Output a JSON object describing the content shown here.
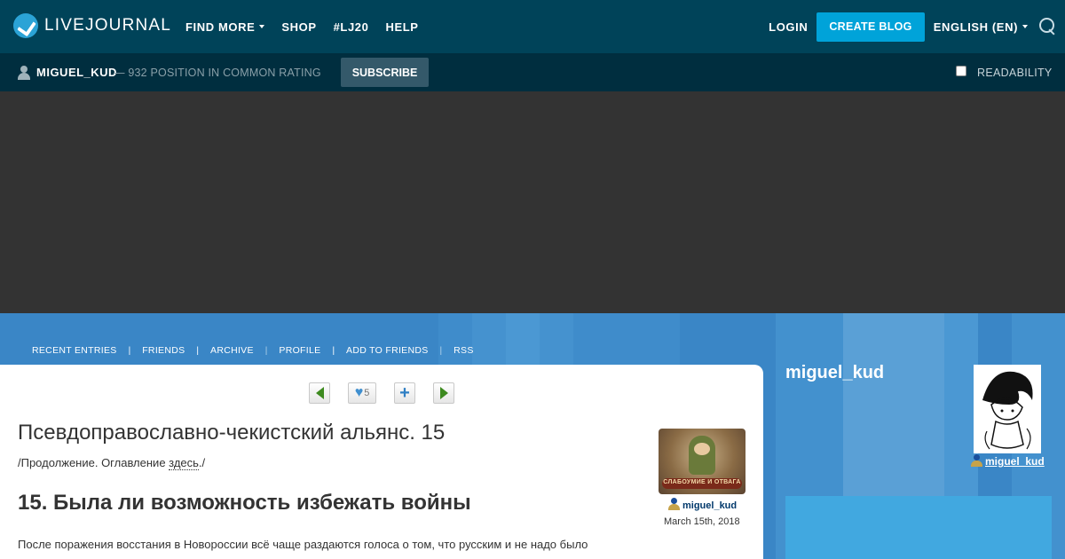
{
  "header": {
    "logo_text": "LIVEJOURNAL",
    "nav": [
      {
        "label": "FIND MORE",
        "has_dropdown": true
      },
      {
        "label": "SHOP",
        "has_dropdown": false
      },
      {
        "label": "#LJ20",
        "has_dropdown": false
      },
      {
        "label": "HELP",
        "has_dropdown": false
      }
    ],
    "login_label": "LOGIN",
    "create_blog_label": "CREATE BLOG",
    "language_label": "ENGLISH (EN)"
  },
  "subbar": {
    "username": "MIGUEL_KUD",
    "rating_text": "— 932 POSITION IN COMMON RATING",
    "subscribe_label": "SUBSCRIBE",
    "readability_label": "READABILITY",
    "readability_checked": false
  },
  "journal_nav": {
    "items": [
      "RECENT ENTRIES",
      "FRIENDS",
      "ARCHIVE",
      "PROFILE",
      "ADD TO FRIENDS",
      "RSS"
    ]
  },
  "post": {
    "controls": {
      "like_count": "5"
    },
    "title": "Псевдоправославно-чекистский альянс. 15",
    "intro_prefix": "/Продолжение. Оглавление ",
    "intro_link": "здесь",
    "intro_suffix": "./",
    "heading": "15. Была ли возможность избежать войны",
    "body_start": "После поражения восстания в Новороссии всё чаще раздаются голоса о том, что русским и не надо было",
    "author": "miguel_kud",
    "date": "March 15th, 2018",
    "userpic_caption": "СЛАБОУМИЕ И ОТВАГА"
  },
  "sidebar": {
    "journal_name": "miguel_kud",
    "user_link": "miguel_kud"
  },
  "colors": {
    "header_bg": "#004359",
    "subbar_bg": "#002e3f",
    "accent": "#00a3d9",
    "journal_bg": "#3a86c6"
  }
}
